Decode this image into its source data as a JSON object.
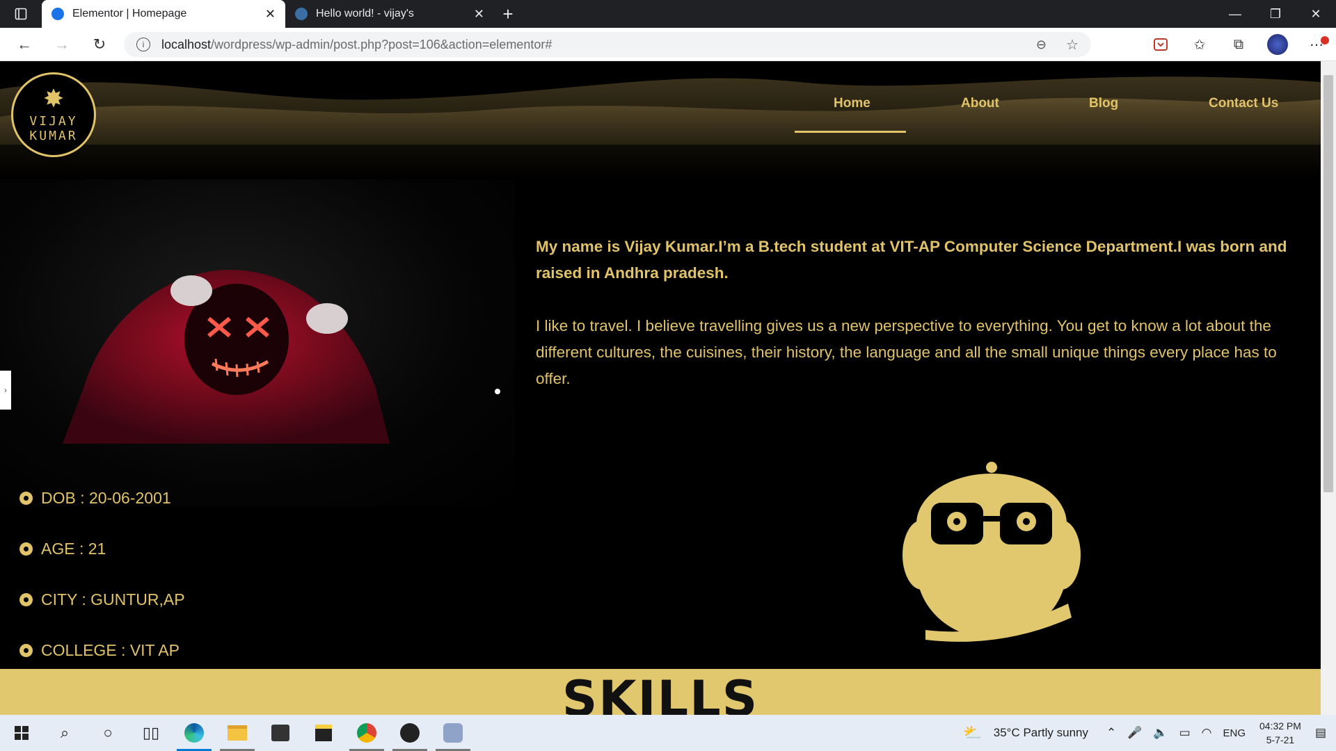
{
  "browser": {
    "tabs": [
      {
        "title": "Elementor | Homepage",
        "active": true
      },
      {
        "title": "Hello world! - vijay's",
        "active": false
      }
    ],
    "url_host": "localhost",
    "url_path": "/wordpress/wp-admin/post.php?post=106&action=elementor#"
  },
  "site": {
    "logo": {
      "line1": "VIJAY",
      "line2": "KUMAR"
    },
    "nav": [
      {
        "label": "Home",
        "active": true
      },
      {
        "label": "About"
      },
      {
        "label": "Blog"
      },
      {
        "label": "Contact Us"
      }
    ],
    "about": {
      "intro": "My name is Vijay Kumar.I’m a B.tech student at VIT-AP Computer Science Department.I was born and raised in Andhra pradesh.",
      "body": "I like to travel. I believe travelling gives us a new perspective to everything. You get to know a lot about the different cultures, the cuisines, their history, the language and all the small unique things every place has to offer."
    },
    "facts": [
      "DOB : 20-06-2001",
      "AGE : 21",
      "CITY : GUNTUR,AP",
      "COLLEGE : VIT AP"
    ],
    "skills_heading": "SKILLS",
    "accent_color": "#e1c36a"
  },
  "taskbar": {
    "weather": "35°C  Partly sunny",
    "language": "ENG",
    "time": "04:32 PM",
    "date": "5-7-21"
  }
}
